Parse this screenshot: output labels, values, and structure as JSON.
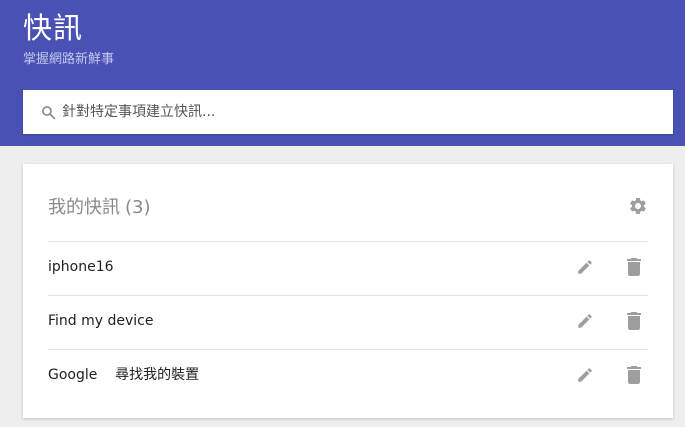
{
  "header": {
    "title": "快訊",
    "subtitle": "掌握網路新鮮事"
  },
  "search": {
    "placeholder": "針對特定事項建立快訊...",
    "icon": "search-icon"
  },
  "alerts_card": {
    "title": "我的快訊",
    "count": "(3)",
    "settings_icon": "gear-icon",
    "items": [
      {
        "label": "iphone16",
        "edit_icon": "pencil-icon",
        "delete_icon": "trash-icon"
      },
      {
        "label": "Find my device",
        "edit_icon": "pencil-icon",
        "delete_icon": "trash-icon"
      },
      {
        "label": "Google    尋找我的裝置",
        "edit_icon": "pencil-icon",
        "delete_icon": "trash-icon"
      }
    ]
  },
  "colors": {
    "header_bg": "#4a51b4",
    "subtitle": "#c3c7ee",
    "page_bg": "#eeeeee",
    "icon_grey": "#9e9e9e"
  }
}
